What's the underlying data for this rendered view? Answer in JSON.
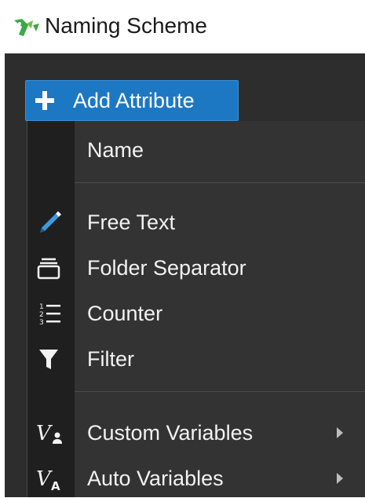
{
  "window": {
    "title": "Naming Scheme",
    "logo_icon": "app-logo-icon"
  },
  "toolbar": {
    "add_attribute_label": "Add Attribute",
    "add_attribute_icon": "plus-icon",
    "accent_color": "#1d78c4"
  },
  "menu": {
    "items": [
      {
        "label": "Name",
        "icon": ""
      },
      {
        "label": "Free Text",
        "icon": "pencil-icon"
      },
      {
        "label": "Folder Separator",
        "icon": "folder-icon"
      },
      {
        "label": "Counter",
        "icon": "numbered-list-icon"
      },
      {
        "label": "Filter",
        "icon": "filter-icon"
      },
      {
        "label": "Custom Variables",
        "icon": "custom-variable-icon",
        "submenu": true
      },
      {
        "label": "Auto Variables",
        "icon": "auto-variable-icon",
        "submenu": true
      }
    ]
  }
}
